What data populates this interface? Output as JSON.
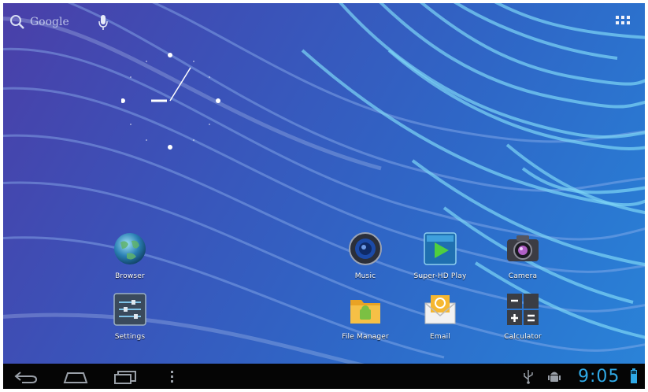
{
  "search": {
    "label": "Google"
  },
  "apps": [
    {
      "id": "browser",
      "label": "Browser"
    },
    {
      "id": "music",
      "label": "Music"
    },
    {
      "id": "superhd",
      "label": "Super-HD Play"
    },
    {
      "id": "camera",
      "label": "Camera"
    },
    {
      "id": "settings",
      "label": "Settings"
    },
    {
      "id": "filemanager",
      "label": "File Manager"
    },
    {
      "id": "email",
      "label": "Email"
    },
    {
      "id": "calculator",
      "label": "Calculator"
    }
  ],
  "status": {
    "time": "9:05"
  },
  "colors": {
    "accent": "#2fa9e6",
    "navbar": "#050505",
    "wallpaper": "#3a55b8"
  }
}
